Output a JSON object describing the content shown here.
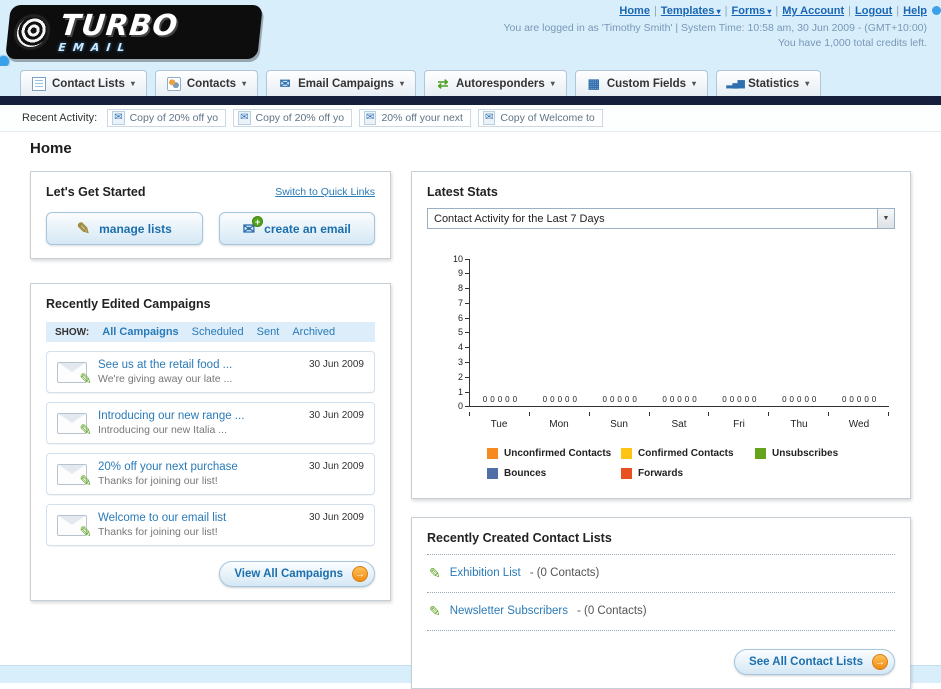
{
  "header": {
    "logo_title": "TURBO",
    "logo_subtitle": "EMAIL",
    "nav": {
      "separator": "|",
      "links": [
        {
          "label": "Home",
          "dropdown": false
        },
        {
          "label": "Templates",
          "dropdown": true
        },
        {
          "label": "Forms",
          "dropdown": true
        },
        {
          "label": "My Account",
          "dropdown": false
        },
        {
          "label": "Logout",
          "dropdown": false
        },
        {
          "label": "Help",
          "dropdown": false
        }
      ]
    },
    "login_info": "You are logged in as 'Timothy Smith' | System Time: 10:58 am, 30 Jun 2009 - (GMT+10:00)",
    "credits_info": "You have 1,000 total credits left."
  },
  "tabs": [
    {
      "label": "Contact Lists"
    },
    {
      "label": "Contacts"
    },
    {
      "label": "Email Campaigns"
    },
    {
      "label": "Autoresponders"
    },
    {
      "label": "Custom Fields"
    },
    {
      "label": "Statistics"
    }
  ],
  "recent_activity": {
    "label": "Recent Activity:",
    "items": [
      "Copy of 20% off yo",
      "Copy of 20% off yo",
      "20% off your next",
      "Copy of Welcome to"
    ]
  },
  "page": {
    "title": "Home"
  },
  "get_started": {
    "title": "Let's Get Started",
    "switch_link": "Switch to Quick Links",
    "manage_lists": "manage lists",
    "create_email": "create an email"
  },
  "campaigns": {
    "title": "Recently Edited Campaigns",
    "show_label": "SHOW:",
    "filters": [
      "All Campaigns",
      "Scheduled",
      "Sent",
      "Archived"
    ],
    "active_filter": "All Campaigns",
    "items": [
      {
        "title": "See us at the retail food ...",
        "subtitle": "We're giving away our late ...",
        "date": "30 Jun 2009"
      },
      {
        "title": "Introducing our new range ...",
        "subtitle": "Introducing our new Italia ...",
        "date": "30 Jun 2009"
      },
      {
        "title": "20% off your next purchase",
        "subtitle": "Thanks for joining our list!",
        "date": "30 Jun 2009"
      },
      {
        "title": "Welcome to our email list",
        "subtitle": "Thanks for joining our list!",
        "date": "30 Jun 2009"
      }
    ],
    "view_all": "View All Campaigns"
  },
  "stats": {
    "title": "Latest Stats",
    "selector": "Contact Activity for the Last 7 Days"
  },
  "chart_data": {
    "type": "bar",
    "title": "Contact Activity for the Last 7 Days",
    "categories": [
      "Tue",
      "Mon",
      "Sun",
      "Sat",
      "Fri",
      "Thu",
      "Wed"
    ],
    "series": [
      {
        "name": "Unconfirmed Contacts",
        "color": "#f6891f",
        "values": [
          0,
          0,
          0,
          0,
          0,
          0,
          0
        ]
      },
      {
        "name": "Confirmed Contacts",
        "color": "#fdc413",
        "values": [
          0,
          0,
          0,
          0,
          0,
          0,
          0
        ]
      },
      {
        "name": "Unsubscribes",
        "color": "#64a41d",
        "values": [
          0,
          0,
          0,
          0,
          0,
          0,
          0
        ]
      },
      {
        "name": "Bounces",
        "color": "#4f6fa7",
        "values": [
          0,
          0,
          0,
          0,
          0,
          0,
          0
        ]
      },
      {
        "name": "Forwards",
        "color": "#e8501f",
        "values": [
          0,
          0,
          0,
          0,
          0,
          0,
          0
        ]
      }
    ],
    "ylim": [
      0,
      10
    ],
    "yticks": [
      0,
      1,
      2,
      3,
      4,
      5,
      6,
      7,
      8,
      9,
      10
    ],
    "legend_position": "bottom",
    "grid": false
  },
  "contact_lists": {
    "title": "Recently Created Contact Lists",
    "items": [
      {
        "name": "Exhibition List",
        "detail": "- (0 Contacts)"
      },
      {
        "name": "Newsletter Subscribers",
        "detail": "- (0 Contacts)"
      }
    ],
    "see_all": "See All Contact Lists"
  }
}
